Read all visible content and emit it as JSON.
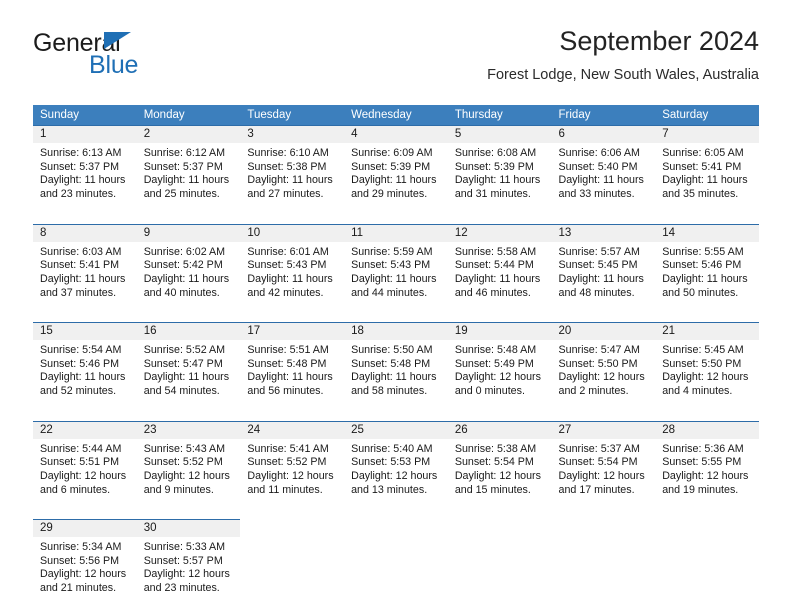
{
  "brand": {
    "name_top": "General",
    "name_bottom": "Blue",
    "accent_color": "#1f6fb5",
    "triangle_icon": "brand-triangle-icon"
  },
  "header": {
    "title": "September 2024",
    "subtitle": "Forest Lodge, New South Wales, Australia"
  },
  "calendar": {
    "header_bg": "#3c7fbd",
    "daynum_bg": "#f0f0f0",
    "row_border_color": "#2d6ca8",
    "weekdays": [
      "Sunday",
      "Monday",
      "Tuesday",
      "Wednesday",
      "Thursday",
      "Friday",
      "Saturday"
    ],
    "weeks": [
      [
        {
          "day": "1",
          "sunrise": "Sunrise: 6:13 AM",
          "sunset": "Sunset: 5:37 PM",
          "daylight_1": "Daylight: 11 hours",
          "daylight_2": "and 23 minutes."
        },
        {
          "day": "2",
          "sunrise": "Sunrise: 6:12 AM",
          "sunset": "Sunset: 5:37 PM",
          "daylight_1": "Daylight: 11 hours",
          "daylight_2": "and 25 minutes."
        },
        {
          "day": "3",
          "sunrise": "Sunrise: 6:10 AM",
          "sunset": "Sunset: 5:38 PM",
          "daylight_1": "Daylight: 11 hours",
          "daylight_2": "and 27 minutes."
        },
        {
          "day": "4",
          "sunrise": "Sunrise: 6:09 AM",
          "sunset": "Sunset: 5:39 PM",
          "daylight_1": "Daylight: 11 hours",
          "daylight_2": "and 29 minutes."
        },
        {
          "day": "5",
          "sunrise": "Sunrise: 6:08 AM",
          "sunset": "Sunset: 5:39 PM",
          "daylight_1": "Daylight: 11 hours",
          "daylight_2": "and 31 minutes."
        },
        {
          "day": "6",
          "sunrise": "Sunrise: 6:06 AM",
          "sunset": "Sunset: 5:40 PM",
          "daylight_1": "Daylight: 11 hours",
          "daylight_2": "and 33 minutes."
        },
        {
          "day": "7",
          "sunrise": "Sunrise: 6:05 AM",
          "sunset": "Sunset: 5:41 PM",
          "daylight_1": "Daylight: 11 hours",
          "daylight_2": "and 35 minutes."
        }
      ],
      [
        {
          "day": "8",
          "sunrise": "Sunrise: 6:03 AM",
          "sunset": "Sunset: 5:41 PM",
          "daylight_1": "Daylight: 11 hours",
          "daylight_2": "and 37 minutes."
        },
        {
          "day": "9",
          "sunrise": "Sunrise: 6:02 AM",
          "sunset": "Sunset: 5:42 PM",
          "daylight_1": "Daylight: 11 hours",
          "daylight_2": "and 40 minutes."
        },
        {
          "day": "10",
          "sunrise": "Sunrise: 6:01 AM",
          "sunset": "Sunset: 5:43 PM",
          "daylight_1": "Daylight: 11 hours",
          "daylight_2": "and 42 minutes."
        },
        {
          "day": "11",
          "sunrise": "Sunrise: 5:59 AM",
          "sunset": "Sunset: 5:43 PM",
          "daylight_1": "Daylight: 11 hours",
          "daylight_2": "and 44 minutes."
        },
        {
          "day": "12",
          "sunrise": "Sunrise: 5:58 AM",
          "sunset": "Sunset: 5:44 PM",
          "daylight_1": "Daylight: 11 hours",
          "daylight_2": "and 46 minutes."
        },
        {
          "day": "13",
          "sunrise": "Sunrise: 5:57 AM",
          "sunset": "Sunset: 5:45 PM",
          "daylight_1": "Daylight: 11 hours",
          "daylight_2": "and 48 minutes."
        },
        {
          "day": "14",
          "sunrise": "Sunrise: 5:55 AM",
          "sunset": "Sunset: 5:46 PM",
          "daylight_1": "Daylight: 11 hours",
          "daylight_2": "and 50 minutes."
        }
      ],
      [
        {
          "day": "15",
          "sunrise": "Sunrise: 5:54 AM",
          "sunset": "Sunset: 5:46 PM",
          "daylight_1": "Daylight: 11 hours",
          "daylight_2": "and 52 minutes."
        },
        {
          "day": "16",
          "sunrise": "Sunrise: 5:52 AM",
          "sunset": "Sunset: 5:47 PM",
          "daylight_1": "Daylight: 11 hours",
          "daylight_2": "and 54 minutes."
        },
        {
          "day": "17",
          "sunrise": "Sunrise: 5:51 AM",
          "sunset": "Sunset: 5:48 PM",
          "daylight_1": "Daylight: 11 hours",
          "daylight_2": "and 56 minutes."
        },
        {
          "day": "18",
          "sunrise": "Sunrise: 5:50 AM",
          "sunset": "Sunset: 5:48 PM",
          "daylight_1": "Daylight: 11 hours",
          "daylight_2": "and 58 minutes."
        },
        {
          "day": "19",
          "sunrise": "Sunrise: 5:48 AM",
          "sunset": "Sunset: 5:49 PM",
          "daylight_1": "Daylight: 12 hours",
          "daylight_2": "and 0 minutes."
        },
        {
          "day": "20",
          "sunrise": "Sunrise: 5:47 AM",
          "sunset": "Sunset: 5:50 PM",
          "daylight_1": "Daylight: 12 hours",
          "daylight_2": "and 2 minutes."
        },
        {
          "day": "21",
          "sunrise": "Sunrise: 5:45 AM",
          "sunset": "Sunset: 5:50 PM",
          "daylight_1": "Daylight: 12 hours",
          "daylight_2": "and 4 minutes."
        }
      ],
      [
        {
          "day": "22",
          "sunrise": "Sunrise: 5:44 AM",
          "sunset": "Sunset: 5:51 PM",
          "daylight_1": "Daylight: 12 hours",
          "daylight_2": "and 6 minutes."
        },
        {
          "day": "23",
          "sunrise": "Sunrise: 5:43 AM",
          "sunset": "Sunset: 5:52 PM",
          "daylight_1": "Daylight: 12 hours",
          "daylight_2": "and 9 minutes."
        },
        {
          "day": "24",
          "sunrise": "Sunrise: 5:41 AM",
          "sunset": "Sunset: 5:52 PM",
          "daylight_1": "Daylight: 12 hours",
          "daylight_2": "and 11 minutes."
        },
        {
          "day": "25",
          "sunrise": "Sunrise: 5:40 AM",
          "sunset": "Sunset: 5:53 PM",
          "daylight_1": "Daylight: 12 hours",
          "daylight_2": "and 13 minutes."
        },
        {
          "day": "26",
          "sunrise": "Sunrise: 5:38 AM",
          "sunset": "Sunset: 5:54 PM",
          "daylight_1": "Daylight: 12 hours",
          "daylight_2": "and 15 minutes."
        },
        {
          "day": "27",
          "sunrise": "Sunrise: 5:37 AM",
          "sunset": "Sunset: 5:54 PM",
          "daylight_1": "Daylight: 12 hours",
          "daylight_2": "and 17 minutes."
        },
        {
          "day": "28",
          "sunrise": "Sunrise: 5:36 AM",
          "sunset": "Sunset: 5:55 PM",
          "daylight_1": "Daylight: 12 hours",
          "daylight_2": "and 19 minutes."
        }
      ],
      [
        {
          "day": "29",
          "sunrise": "Sunrise: 5:34 AM",
          "sunset": "Sunset: 5:56 PM",
          "daylight_1": "Daylight: 12 hours",
          "daylight_2": "and 21 minutes."
        },
        {
          "day": "30",
          "sunrise": "Sunrise: 5:33 AM",
          "sunset": "Sunset: 5:57 PM",
          "daylight_1": "Daylight: 12 hours",
          "daylight_2": "and 23 minutes."
        },
        {
          "day": "",
          "sunrise": "",
          "sunset": "",
          "daylight_1": "",
          "daylight_2": ""
        },
        {
          "day": "",
          "sunrise": "",
          "sunset": "",
          "daylight_1": "",
          "daylight_2": ""
        },
        {
          "day": "",
          "sunrise": "",
          "sunset": "",
          "daylight_1": "",
          "daylight_2": ""
        },
        {
          "day": "",
          "sunrise": "",
          "sunset": "",
          "daylight_1": "",
          "daylight_2": ""
        },
        {
          "day": "",
          "sunrise": "",
          "sunset": "",
          "daylight_1": "",
          "daylight_2": ""
        }
      ]
    ]
  }
}
